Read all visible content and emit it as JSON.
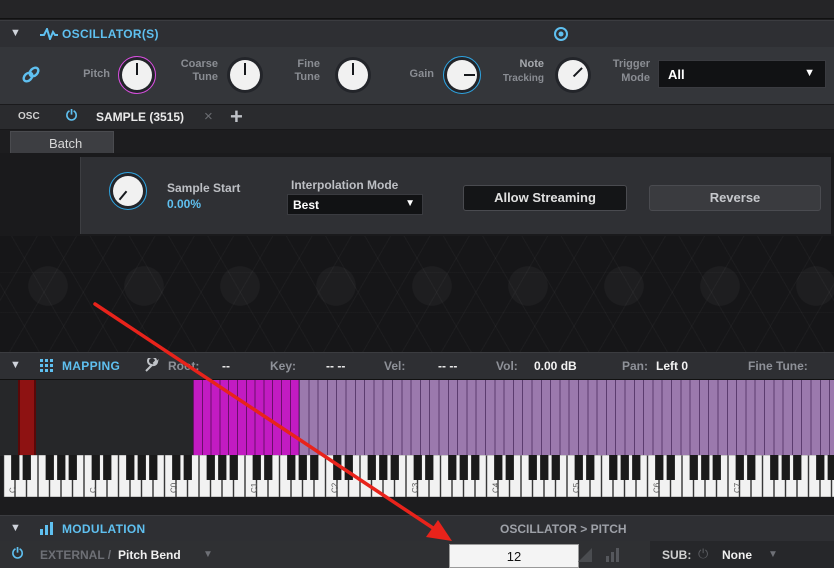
{
  "oscillator": {
    "title": "OSCILLATOR(S)",
    "pitch_label": "Pitch",
    "coarse_label": "Coarse Tune",
    "fine_label": "Fine Tune",
    "gain_label": "Gain",
    "note_label": "Note",
    "tracking_label": "Tracking",
    "trigger_label": "Trigger",
    "mode_label": "Mode",
    "trigger_value": "All"
  },
  "tabs": {
    "osc_label": "OSC",
    "sample_label": "SAMPLE (3515)"
  },
  "batch_label": "Batch",
  "sample": {
    "start_label": "Sample Start",
    "start_value": "0.00%",
    "interp_label": "Interpolation Mode",
    "interp_value": "Best",
    "allow_streaming": "Allow Streaming",
    "reverse": "Reverse"
  },
  "mapping": {
    "title": "MAPPING",
    "root_label": "Root:",
    "root_value": "--",
    "key_label": "Key:",
    "key_value": "-- --",
    "vel_label": "Vel:",
    "vel_value": "-- --",
    "vol_label": "Vol:",
    "vol_value": "0.00 dB",
    "pan_label": "Pan:",
    "pan_value": "Left 0",
    "finetune_label": "Fine Tune:"
  },
  "keyboard": {
    "octave_labels": [
      "C",
      "C",
      "C0",
      "C1",
      "C2",
      "C3",
      "C4",
      "C5",
      "C6",
      "C7"
    ]
  },
  "modulation": {
    "title": "MODULATION",
    "path": "OSCILLATOR > PITCH",
    "source_prefix": "EXTERNAL /",
    "source_value": "Pitch Bend",
    "amount_value": "12",
    "sub_label": "SUB:",
    "sub_value": "None"
  },
  "colors": {
    "accent_blue": "#5fc0f0",
    "pitch_ring": "#d94fe0",
    "zone_magenta": "#c21bc2",
    "zone_lavender": "#9b79ad",
    "zone_red": "#8e1212",
    "arrow_red": "#e8231b"
  }
}
